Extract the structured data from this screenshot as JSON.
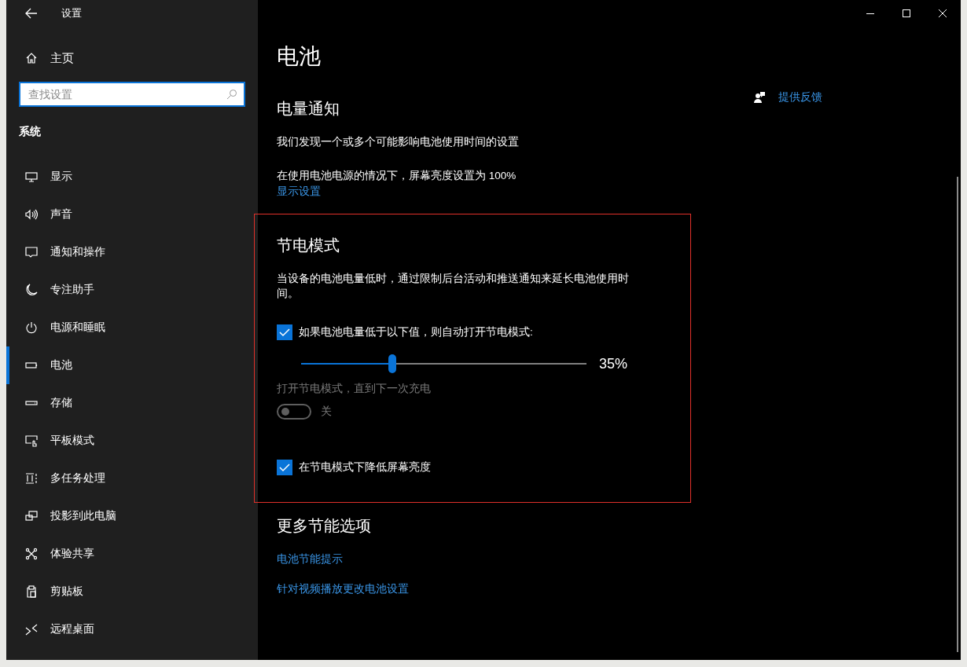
{
  "window": {
    "title": "设置"
  },
  "sidebar": {
    "home": {
      "label": "主页"
    },
    "search": {
      "placeholder": "查找设置"
    },
    "section": "系统",
    "items": [
      {
        "label": "显示",
        "kind": "display",
        "selected": false
      },
      {
        "label": "声音",
        "kind": "sound",
        "selected": false
      },
      {
        "label": "通知和操作",
        "kind": "notification",
        "selected": false
      },
      {
        "label": "专注助手",
        "kind": "moon",
        "selected": false
      },
      {
        "label": "电源和睡眠",
        "kind": "power",
        "selected": false
      },
      {
        "label": "电池",
        "kind": "battery",
        "selected": true
      },
      {
        "label": "存储",
        "kind": "storage",
        "selected": false
      },
      {
        "label": "平板模式",
        "kind": "tablet",
        "selected": false
      },
      {
        "label": "多任务处理",
        "kind": "multitask",
        "selected": false
      },
      {
        "label": "投影到此电脑",
        "kind": "project",
        "selected": false
      },
      {
        "label": "体验共享",
        "kind": "share",
        "selected": false
      },
      {
        "label": "剪贴板",
        "kind": "clipboard",
        "selected": false
      },
      {
        "label": "远程桌面",
        "kind": "remote",
        "selected": false
      }
    ]
  },
  "main": {
    "title": "电池",
    "notification": {
      "heading": "电量通知",
      "text": "我们发现一个或多个可能影响电池使用时间的设置",
      "detail": "在使用电池电源的情况下，屏幕亮度设置为 100%",
      "link": "显示设置"
    },
    "saver": {
      "heading": "节电模式",
      "description": "当设备的电池电量低时，通过限制后台活动和推送通知来延长电池使用时间。",
      "auto": {
        "label": "如果电池电量低于以下值，则自动打开节电模式:",
        "checked": true
      },
      "threshold": {
        "level": 0.32,
        "reading": "35%"
      },
      "until_charge": {
        "label": "打开节电模式，直到下一次充电",
        "on": false,
        "disabled": true,
        "state_text": "关"
      },
      "lower_brightness": {
        "label": "在节电模式下降低屏幕亮度",
        "checked": true
      }
    },
    "more": {
      "heading": "更多节能选项",
      "links": [
        "电池节能提示",
        "针对视频播放更改电池设置"
      ]
    }
  },
  "aside": {
    "links": [
      {
        "label": "提供反馈",
        "kind": "feedback"
      }
    ]
  }
}
